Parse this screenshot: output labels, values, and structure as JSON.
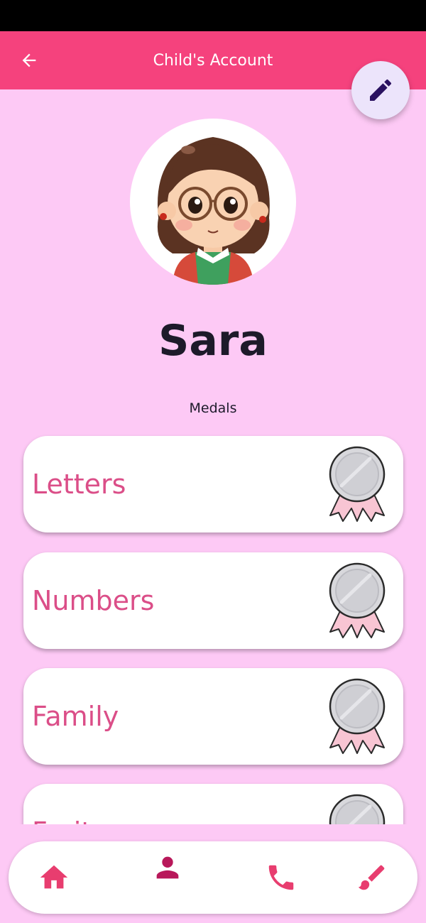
{
  "header": {
    "title": "Child's Account",
    "back_icon": "arrow-left-icon",
    "edit_icon": "pencil-icon"
  },
  "profile": {
    "name": "Sara",
    "avatar": "girl-with-glasses-avatar"
  },
  "medals": {
    "heading": "Medals",
    "items": [
      {
        "label": "Letters",
        "icon": "medal-icon"
      },
      {
        "label": "Numbers",
        "icon": "medal-icon"
      },
      {
        "label": "Family",
        "icon": "medal-icon"
      },
      {
        "label": "Fruits",
        "icon": "medal-icon"
      }
    ]
  },
  "bottom_nav": {
    "items": [
      {
        "icon": "home-icon"
      },
      {
        "icon": "person-icon",
        "active": true
      },
      {
        "icon": "phone-icon"
      },
      {
        "icon": "brush-icon"
      }
    ]
  },
  "colors": {
    "background": "#fdc9f5",
    "app_bar": "#f5427d",
    "medal_text": "#db4e88",
    "nav_icon": "#e83d6f",
    "nav_icon_active": "#b8185a"
  }
}
